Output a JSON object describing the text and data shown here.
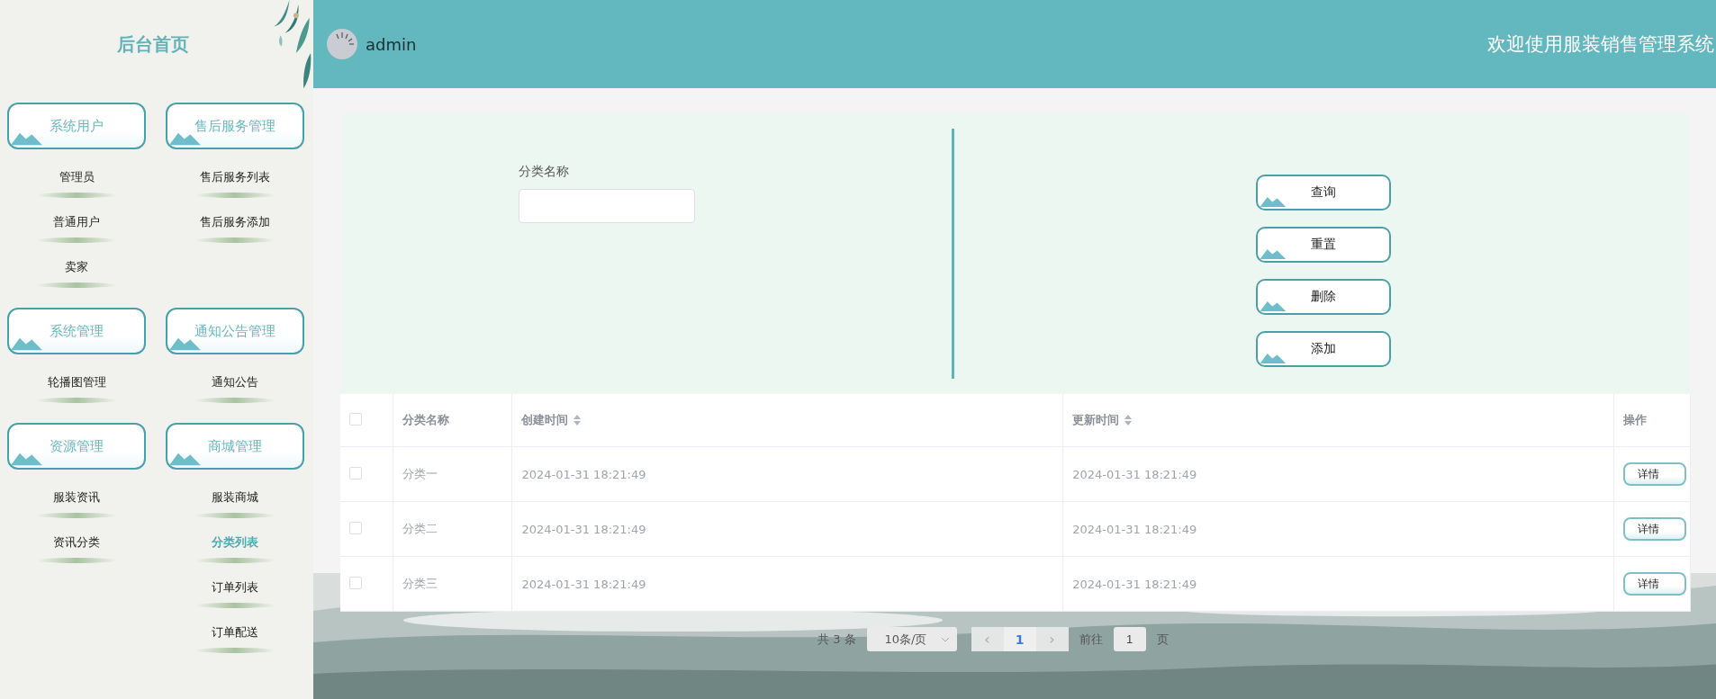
{
  "sidebar": {
    "title": "后台首页",
    "groups": [
      {
        "title": "系统用户",
        "items": [
          {
            "label": "管理员",
            "selected": false
          },
          {
            "label": "普通用户",
            "selected": false
          },
          {
            "label": "卖家",
            "selected": false
          }
        ]
      },
      {
        "title": "售后服务管理",
        "items": [
          {
            "label": "售后服务列表",
            "selected": false
          },
          {
            "label": "售后服务添加",
            "selected": false
          }
        ]
      },
      {
        "title": "系统管理",
        "items": [
          {
            "label": "轮播图管理",
            "selected": false
          }
        ]
      },
      {
        "title": "通知公告管理",
        "items": [
          {
            "label": "通知公告",
            "selected": false
          }
        ]
      },
      {
        "title": "资源管理",
        "items": [
          {
            "label": "服装资讯",
            "selected": false
          },
          {
            "label": "资讯分类",
            "selected": false
          }
        ]
      },
      {
        "title": "商城管理",
        "items": [
          {
            "label": "服装商城",
            "selected": false
          },
          {
            "label": "分类列表",
            "selected": true
          },
          {
            "label": "订单列表",
            "selected": false
          },
          {
            "label": "订单配送",
            "selected": false
          }
        ]
      }
    ]
  },
  "header": {
    "user": "admin",
    "welcome": "欢迎使用服装销售管理系统"
  },
  "search": {
    "label": "分类名称"
  },
  "actions": [
    "查询",
    "重置",
    "删除",
    "添加"
  ],
  "table": {
    "columns": [
      {
        "label": "分类名称",
        "sortable": false
      },
      {
        "label": "创建时间",
        "sortable": true
      },
      {
        "label": "更新时间",
        "sortable": true
      },
      {
        "label": "操作",
        "sortable": false
      }
    ],
    "header_checked": false,
    "rows": [
      {
        "checked": false,
        "name": "分类一",
        "created": "2024-01-31 18:21:49",
        "updated": "2024-01-31 18:21:49",
        "action": "详情"
      },
      {
        "checked": false,
        "name": "分类二",
        "created": "2024-01-31 18:21:49",
        "updated": "2024-01-31 18:21:49",
        "action": "详情"
      },
      {
        "checked": false,
        "name": "分类三",
        "created": "2024-01-31 18:21:49",
        "updated": "2024-01-31 18:21:49",
        "action": "详情"
      }
    ]
  },
  "pagination": {
    "total": "共 3 条",
    "page_size": "10条/页",
    "prev": "‹",
    "pages": [
      {
        "label": "1",
        "selected": true
      }
    ],
    "next": "›",
    "goto_label": "前往",
    "goto_value": "1",
    "goto_suffix": "页"
  }
}
